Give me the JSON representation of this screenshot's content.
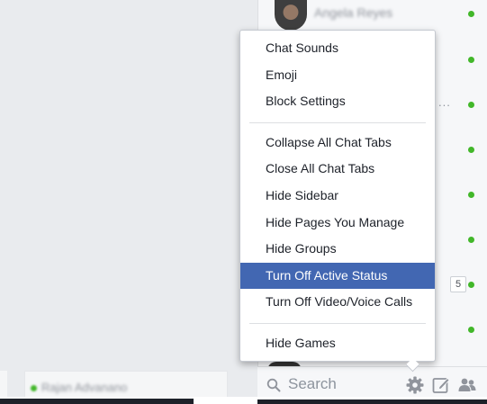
{
  "sidebar": {
    "top_contact_name": "Angela Reyes",
    "badge_count": "5",
    "ellipsis": "..."
  },
  "search": {
    "placeholder": "Search"
  },
  "chat_tab": {
    "name": "Rajan Advanano"
  },
  "menu": {
    "group1": [
      {
        "label": "Chat Sounds"
      },
      {
        "label": "Emoji"
      },
      {
        "label": "Block Settings"
      }
    ],
    "group2": [
      {
        "label": "Collapse All Chat Tabs"
      },
      {
        "label": "Close All Chat Tabs"
      },
      {
        "label": "Hide Sidebar"
      },
      {
        "label": "Hide Pages You Manage"
      },
      {
        "label": "Hide Groups"
      },
      {
        "label": "Turn Off Active Status"
      },
      {
        "label": "Turn Off Video/Voice Calls"
      }
    ],
    "group3": [
      {
        "label": "Hide Games"
      }
    ],
    "highlighted": "Turn Off Active Status"
  },
  "colors": {
    "highlight": "#4267b2",
    "online": "#42b72a"
  },
  "icons": [
    "search-icon",
    "gear-icon",
    "compose-icon",
    "people-icon"
  ]
}
